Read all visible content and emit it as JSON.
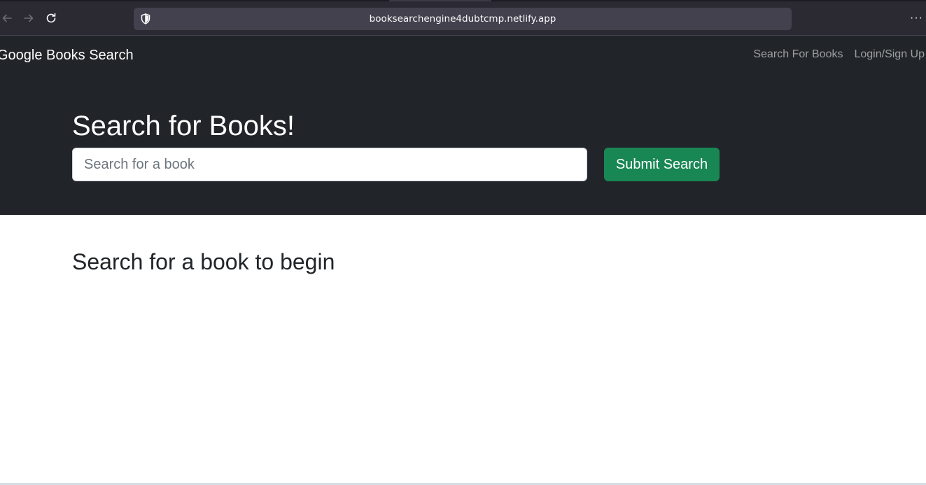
{
  "browser": {
    "url": "booksearchengine4dubtcmp.netlify.app",
    "menu_glyph": "···",
    "icons": [
      "back-arrow-icon",
      "forward-arrow-icon",
      "reload-icon",
      "shield-icon",
      "more-menu-icon"
    ]
  },
  "navbar": {
    "brand": "Google Books Search",
    "links": [
      "Search For Books",
      "Login/Sign Up"
    ]
  },
  "hero": {
    "title": "Search for Books!",
    "search_placeholder": "Search for a book",
    "search_value": "",
    "submit_label": "Submit Search"
  },
  "results": {
    "heading": "Search for a book to begin"
  },
  "colors": {
    "dark_bg": "#212529",
    "submit_green": "#198754",
    "browser_chrome": "#2b2a33",
    "url_field": "#42414d"
  }
}
